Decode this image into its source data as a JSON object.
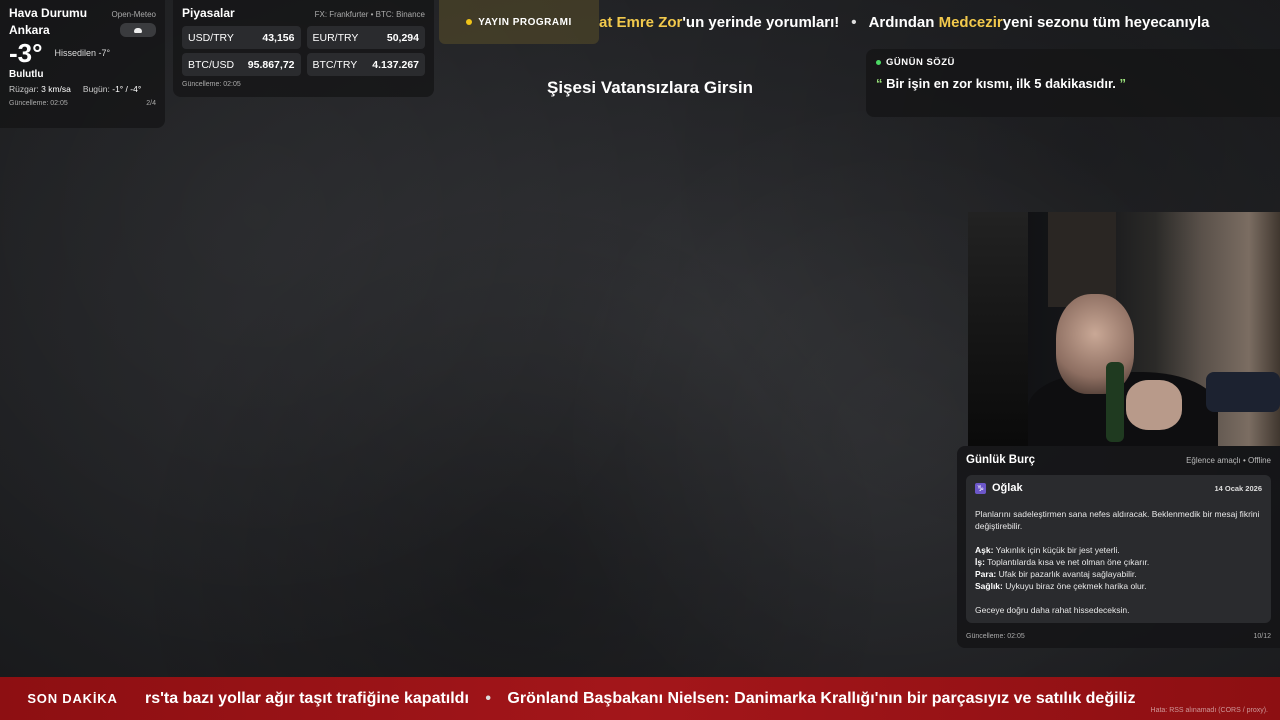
{
  "weather": {
    "title": "Hava Durumu",
    "source": "Open-Meteo",
    "city": "Ankara",
    "icon": "cloud-icon",
    "temperature": "-3°",
    "feels_like": "Hissedilen -7°",
    "condition": "Bulutlu",
    "wind_label": "Rüzgar:",
    "wind_value": "3 km/sa",
    "today_label": "Bugün:",
    "today_value": "-1° / -4°",
    "updated": "Güncelleme: 02:05",
    "page": "2/4"
  },
  "markets": {
    "title": "Piyasalar",
    "source": "FX: Frankfurter • BTC: Binance",
    "items": [
      {
        "label": "USD/TRY",
        "value": "43,156"
      },
      {
        "label": "EUR/TRY",
        "value": "50,294"
      },
      {
        "label": "BTC/USD",
        "value": "95.867,72"
      },
      {
        "label": "BTC/TRY",
        "value": "4.137.267"
      }
    ],
    "updated": "Güncelleme: 02:05"
  },
  "schedule": {
    "label": "YAYIN PROGRAMI",
    "ticker_part1_hl": "at Emre Zor",
    "ticker_part1": "'un yerinde yorumları!",
    "ticker_sep": "•",
    "ticker_part2_pre": "Ardından ",
    "ticker_part2_hl": "Medcezir",
    "ticker_part2": " yeni sezonu tüm heyecanıyla"
  },
  "stream_title": "Şişesi Vatansızlara Girsin",
  "quote": {
    "label": "GÜNÜN SÖZÜ",
    "open_mark": "“",
    "text": "Bir işin en zor kısmı, ilk 5 dakikasıdır.",
    "close_mark": "”"
  },
  "horoscope": {
    "title": "Günlük Burç",
    "mode": "Eğlence amaçlı • Offline",
    "sign_icon": "♑",
    "sign": "Oğlak",
    "date": "14 Ocak 2026",
    "intro": "Planlarını sadeleştirmen sana nefes aldıracak. Beklenmedik bir mesaj fikrini değiştirebilir.",
    "love_label": "Aşk:",
    "love": "Yakınlık için küçük bir jest yeterli.",
    "work_label": "İş:",
    "work": "Toplantılarda kısa ve net olman öne çıkarır.",
    "money_label": "Para:",
    "money": "Ufak bir pazarlık avantaj sağlayabilir.",
    "health_label": "Sağlık:",
    "health": "Uykuyu biraz öne çekmek harika olur.",
    "outro": "Geceye doğru daha rahat hissedeceksin.",
    "updated": "Güncelleme: 02:05",
    "page": "10/12"
  },
  "breaking": {
    "label": "SON DAKİKA",
    "text1": "rs'ta bazı yollar ağır taşıt trafiğine kapatıldı",
    "sep": "•",
    "text2": "Grönland Başbakanı Nielsen: Danimarka Krallığı'nın bir parçasıyız ve satılık değiliz",
    "error": "Hata: RSS alınamadı (CORS / proxy)."
  },
  "colors": {
    "accent_yellow": "#f2c94c",
    "breaking_red": "#a3161a",
    "quote_green": "#9be27c"
  }
}
